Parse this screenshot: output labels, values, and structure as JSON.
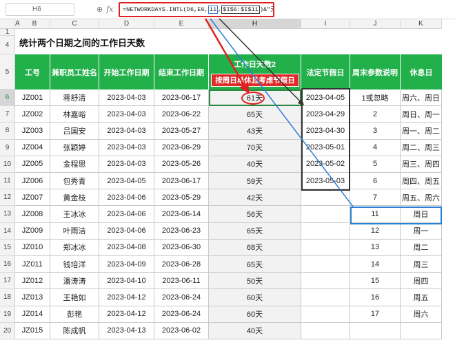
{
  "formula_bar": {
    "cell_ref": "H6",
    "icons": [
      "zoom-icon",
      "fx-icon"
    ],
    "formula_head": "=NETWORKDAYS.INTL(D6,E6,",
    "formula_weekend": "11",
    "formula_sep": ",",
    "formula_holidays": "$I$6:$I$11",
    "formula_tail": ")&\"天\""
  },
  "columns": [
    "A",
    "B",
    "C",
    "D",
    "E",
    "H",
    "I",
    "J",
    "K"
  ],
  "rows": [
    "1",
    "4",
    "5",
    "6",
    "7",
    "8",
    "9",
    "10",
    "11",
    "12",
    "13",
    "14",
    "15",
    "16",
    "17",
    "18",
    "19",
    "20"
  ],
  "title": "统计两个日期之间的工作日天数",
  "headers": {
    "id": "工号",
    "name": "兼职员工姓名",
    "start": "开始工作日期",
    "end": "结束工作日期",
    "workdays": "工作日天数2",
    "workdays_note": "按周日单休且考虑节假日",
    "holiday": "法定节假日",
    "weekend_param": "周末参数说明",
    "rest_day": "休息日"
  },
  "employees": [
    {
      "id": "JZ001",
      "name": "蒋舒清",
      "start": "2023-04-03",
      "end": "2023-06-17",
      "days": "61天"
    },
    {
      "id": "JZ002",
      "name": "林嘉峪",
      "start": "2023-04-03",
      "end": "2023-06-22",
      "days": "65天"
    },
    {
      "id": "JZ003",
      "name": "吕国安",
      "start": "2023-04-03",
      "end": "2023-05-27",
      "days": "43天"
    },
    {
      "id": "JZ004",
      "name": "张颖婷",
      "start": "2023-04-03",
      "end": "2023-06-29",
      "days": "70天"
    },
    {
      "id": "JZ005",
      "name": "金程思",
      "start": "2023-04-03",
      "end": "2023-05-26",
      "days": "40天"
    },
    {
      "id": "JZ006",
      "name": "包秀青",
      "start": "2023-04-05",
      "end": "2023-06-17",
      "days": "59天"
    },
    {
      "id": "JZ007",
      "name": "黄金枝",
      "start": "2023-04-06",
      "end": "2023-05-29",
      "days": "42天"
    },
    {
      "id": "JZ008",
      "name": "王冰冰",
      "start": "2023-04-06",
      "end": "2023-06-14",
      "days": "56天"
    },
    {
      "id": "JZ009",
      "name": "叶雨洁",
      "start": "2023-04-06",
      "end": "2023-06-23",
      "days": "65天"
    },
    {
      "id": "JZ010",
      "name": "郑冰冰",
      "start": "2023-04-08",
      "end": "2023-06-30",
      "days": "68天"
    },
    {
      "id": "JZ011",
      "name": "钱培洋",
      "start": "2023-04-09",
      "end": "2023-06-28",
      "days": "65天"
    },
    {
      "id": "JZ012",
      "name": "潘涛涛",
      "start": "2023-04-10",
      "end": "2023-06-11",
      "days": "50天"
    },
    {
      "id": "JZ013",
      "name": "王艳如",
      "start": "2023-04-12",
      "end": "2023-06-24",
      "days": "60天"
    },
    {
      "id": "JZ014",
      "name": "彭艳",
      "start": "2023-04-12",
      "end": "2023-06-24",
      "days": "60天"
    },
    {
      "id": "JZ015",
      "name": "陈成帆",
      "start": "2023-04-13",
      "end": "2023-06-02",
      "days": "40天"
    }
  ],
  "holidays": [
    "2023-04-05",
    "2023-04-29",
    "2023-04-30",
    "2023-05-01",
    "2023-05-02",
    "2023-05-03"
  ],
  "weekend_params": [
    {
      "param": "1或忽略",
      "rest": "周六、周日"
    },
    {
      "param": "2",
      "rest": "周日、周一"
    },
    {
      "param": "3",
      "rest": "周一、周二"
    },
    {
      "param": "4",
      "rest": "周二、周三"
    },
    {
      "param": "5",
      "rest": "周三、周四"
    },
    {
      "param": "6",
      "rest": "周四、周五"
    },
    {
      "param": "7",
      "rest": "周五、周六"
    },
    {
      "param": "11",
      "rest": "周日"
    },
    {
      "param": "12",
      "rest": "周一"
    },
    {
      "param": "13",
      "rest": "周二"
    },
    {
      "param": "14",
      "rest": "周三"
    },
    {
      "param": "15",
      "rest": "周四"
    },
    {
      "param": "16",
      "rest": "周五"
    },
    {
      "param": "17",
      "rest": "周六"
    }
  ],
  "colors": {
    "header_green": "#22b04a",
    "note_red": "#e12a2a",
    "highlight_blue": "#2b7fd4",
    "box_dark": "#333333"
  }
}
